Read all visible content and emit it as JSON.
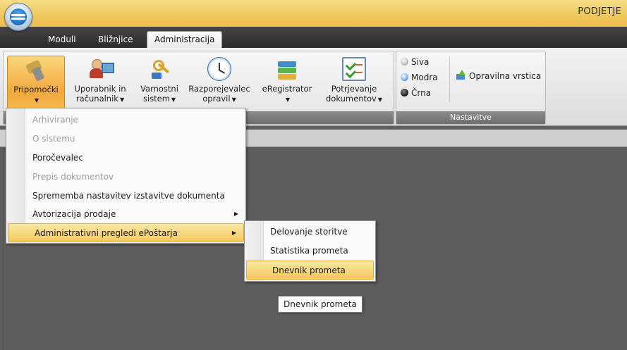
{
  "app": {
    "title": "PODJETJE"
  },
  "tabs": [
    {
      "label": "Moduli"
    },
    {
      "label": "Bližnjice"
    },
    {
      "label": "Administracija"
    }
  ],
  "ribbon": {
    "buttons": [
      {
        "label1": "Pripomočki",
        "label2": "",
        "icon": "tools-icon"
      },
      {
        "label1": "Uporabnik in",
        "label2": "računalnik",
        "icon": "user-computer-icon"
      },
      {
        "label1": "Varnostni",
        "label2": "sistem",
        "icon": "keys-icon"
      },
      {
        "label1": "Razporejevalec",
        "label2": "opravil",
        "icon": "clock-icon"
      },
      {
        "label1": "eRegistrator",
        "label2": "",
        "icon": "books-icon"
      },
      {
        "label1": "Potrjevanje",
        "label2": "dokumentov",
        "icon": "checklist-icon"
      }
    ],
    "nastavitve": {
      "group_label": "Nastavitve",
      "options": [
        {
          "label": "Siva"
        },
        {
          "label": "Modra"
        },
        {
          "label": "Črna"
        }
      ],
      "taskbar_label": "Opravilna vrstica"
    }
  },
  "menu": {
    "items": [
      {
        "label": "Arhiviranje",
        "enabled": false
      },
      {
        "label": "O sistemu",
        "enabled": false
      },
      {
        "label": "Poročevalec",
        "enabled": true
      },
      {
        "label": "Prepis dokumentov",
        "enabled": false
      },
      {
        "label": "Sprememba nastavitev izstavitve dokumenta",
        "enabled": true
      },
      {
        "label": "Avtorizacija prodaje",
        "enabled": true,
        "submenu": true
      },
      {
        "label": "Administrativni pregledi ePoštarja",
        "enabled": true,
        "submenu": true,
        "highlighted": true
      }
    ]
  },
  "submenu": {
    "items": [
      {
        "label": "Delovanje storitve"
      },
      {
        "label": "Statistika prometa"
      },
      {
        "label": "Dnevnik prometa",
        "highlighted": true
      }
    ]
  },
  "tooltip": {
    "text": "Dnevnik prometa"
  }
}
